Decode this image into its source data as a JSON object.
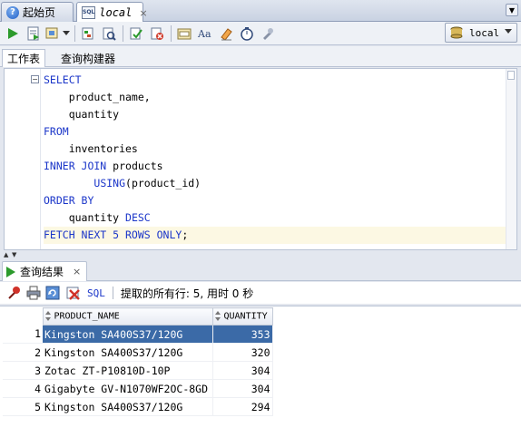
{
  "tabs": [
    {
      "label": "起始页",
      "icon": "help-icon"
    },
    {
      "label": "local",
      "icon": "sql-worksheet-icon",
      "close": "×"
    }
  ],
  "connection": {
    "selected": "local"
  },
  "subtabs": [
    "工作表",
    "查询构建器"
  ],
  "editor": {
    "lines": [
      [
        {
          "t": "SELECT",
          "k": true
        }
      ],
      [
        {
          "t": "    product_name,"
        }
      ],
      [
        {
          "t": "    quantity"
        }
      ],
      [
        {
          "t": "FROM",
          "k": true
        }
      ],
      [
        {
          "t": "    inventories"
        }
      ],
      [
        {
          "t": "INNER JOIN",
          "k": true
        },
        {
          "t": " products"
        }
      ],
      [
        {
          "t": "        "
        },
        {
          "t": "USING",
          "k": true
        },
        {
          "t": "(product_id)"
        }
      ],
      [
        {
          "t": "ORDER BY",
          "k": true
        }
      ],
      [
        {
          "t": "    quantity "
        },
        {
          "t": "DESC",
          "k": true
        }
      ],
      [
        {
          "t": "FETCH NEXT 5 ROWS ONLY",
          "k": true
        },
        {
          "t": ";"
        }
      ]
    ],
    "fold_marker": "−"
  },
  "results": {
    "tab_label": "查询结果",
    "tab_close": "×",
    "sql_link": "SQL",
    "status": "提取的所有行: 5, 用时 0 秒",
    "columns": [
      "PRODUCT_NAME",
      "QUANTITY"
    ],
    "rows": [
      {
        "n": "1",
        "name": "Kingston SA400S37/120G",
        "qty": "353"
      },
      {
        "n": "2",
        "name": "Kingston SA400S37/120G",
        "qty": "320"
      },
      {
        "n": "3",
        "name": "Zotac ZT-P10810D-10P",
        "qty": "304"
      },
      {
        "n": "4",
        "name": "Gigabyte GV-N1070WF2OC-8GD",
        "qty": "304"
      },
      {
        "n": "5",
        "name": "Kingston SA400S37/120G",
        "qty": "294"
      }
    ],
    "selected_row": 0
  },
  "colors": {
    "keyword": "#1b36c9",
    "selection": "#3b6aa7",
    "current_line": "#fcf8e3"
  }
}
